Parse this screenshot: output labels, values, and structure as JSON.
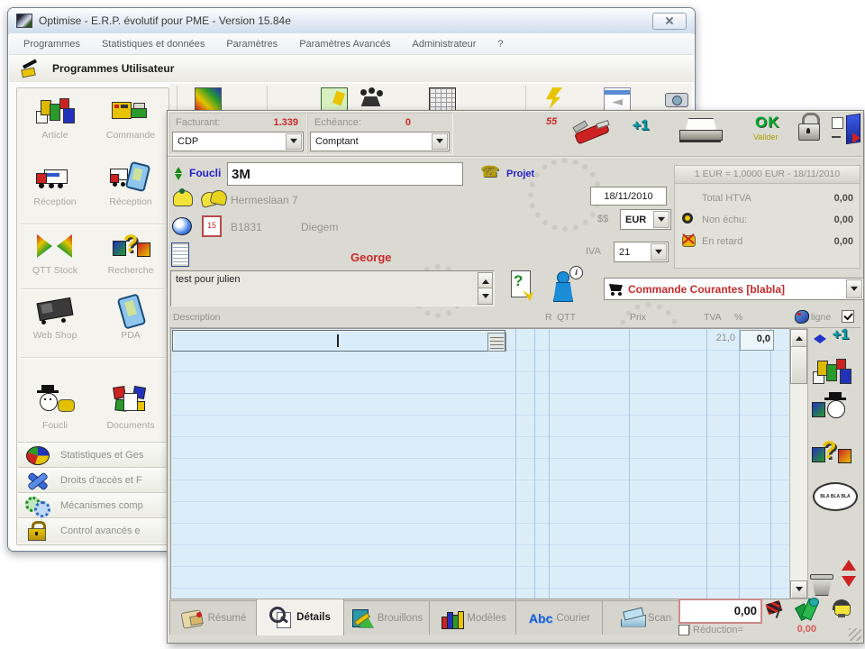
{
  "main_window": {
    "title": "Optimise - E.R.P. évolutif pour PME - Version 15.84e",
    "menu_items": [
      "Programmes",
      "Statistiques et données",
      "Paramètres",
      "Paramètres Avancés",
      "Administrateur",
      "?"
    ],
    "banner_title": "Programmes Utilisateur",
    "programs": [
      {
        "label": "Article"
      },
      {
        "label": "Commande"
      },
      {
        "label": "Réception"
      },
      {
        "label": "Réception"
      },
      {
        "label": "QTT Stock"
      },
      {
        "label": "Recherche"
      },
      {
        "label": "Web Shop"
      },
      {
        "label": "PDA"
      },
      {
        "label": "Foucli"
      },
      {
        "label": "Documents"
      }
    ],
    "admin_items": [
      {
        "label": "Statistiques et Ges"
      },
      {
        "label": "Droits d'accès et F"
      },
      {
        "label": "Mécanismes comp"
      },
      {
        "label": "Control avancés e"
      }
    ]
  },
  "invoice": {
    "facturant_label": "Facturant:",
    "facturant_count": "1.339",
    "facturant_value": "CDP",
    "echeance_label": "Echéance:",
    "echeance_count": "0",
    "echeance_value": "Comptant",
    "percent_badge": "55",
    "ok_label": "OK",
    "valider_label": "Valider",
    "client_section_label": "Foucli",
    "client_name": "3M",
    "projet_label": "Projet",
    "address_line": "Hermeslaan 7",
    "postal_code": "B1831",
    "city": "Diegem",
    "contact_name": "George",
    "date_value": "18/11/2010",
    "currency_symbol": "$$",
    "currency_value": "EUR",
    "vat_label": "IVA",
    "vat_value": "21",
    "exchange_banner": "1 EUR = 1,0000 EUR - 18/11/2010",
    "totals": [
      {
        "label": "Total HTVA",
        "value": "0,00"
      },
      {
        "label": "Non échu:",
        "value": "0,00"
      },
      {
        "label": "En retard",
        "value": "0,00"
      }
    ],
    "memo_text": "test pour julien",
    "order_type": "Commande Courantes [blabla]",
    "grid": {
      "col_description": "Description",
      "col_r": "R",
      "col_qtt": "QTT",
      "col_prix": "Prix",
      "col_tva": "TVA",
      "col_pct": "%",
      "multiline_label": "ligne",
      "row_tva": "21,0",
      "row_pct": "0,0"
    },
    "tabs": [
      {
        "label": "Résumé"
      },
      {
        "label": "Détails"
      },
      {
        "label": "Brouillons"
      },
      {
        "label": "Modèles"
      },
      {
        "label": "Courier"
      },
      {
        "label": "Scan"
      }
    ],
    "total_value": "0,00",
    "reduction_label": "Réduction=",
    "reduction_value": "0,00"
  },
  "icons": {
    "plus_one": "+1",
    "question": "?",
    "abc": "Abc",
    "calendar_day": "15",
    "phone": "☎",
    "blabla": "BLA BLA BLA",
    "info": "i"
  },
  "colors": {
    "accent_red": "#c92a2a",
    "accent_blue": "#2222cc",
    "ok_green": "#00a830",
    "grid_bg": "#dcedfa"
  }
}
